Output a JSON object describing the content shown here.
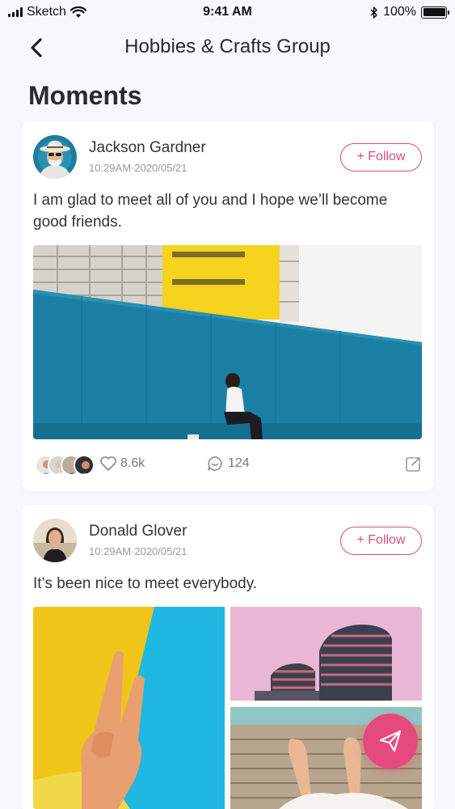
{
  "status_bar": {
    "carrier": "Sketch",
    "time": "9:41 AM",
    "battery": "100%",
    "battery_level": 1.0
  },
  "header": {
    "title": "Hobbies & Crafts Group",
    "back_icon": "chevron-left-icon"
  },
  "page_title": "Moments",
  "posts": [
    {
      "author": "Jackson Gardner",
      "time": "10:29AM·2020/05/21",
      "follow_label": "+ Follow",
      "text": "I am glad to meet all of you and I hope we’ll become good friends.",
      "likes": "8.6k",
      "comments": "124"
    },
    {
      "author": "Donald Glover",
      "time": "10:29AM·2020/05/21",
      "follow_label": "+ Follow",
      "text": "It’s been nice to meet everybody."
    }
  ],
  "fab_icon": "send-icon",
  "colors": {
    "accent": "#de4a7f",
    "fab": "#e54a7e",
    "background": "#f7f8fb",
    "wall_blue": "#1a7fa3",
    "building_yellow": "#f5d31f"
  }
}
